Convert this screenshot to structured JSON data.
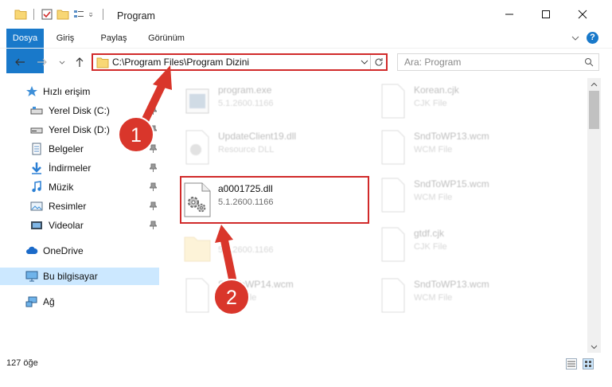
{
  "window": {
    "title": "Program",
    "controls": {
      "minimize": "minimize-icon",
      "maximize": "maximize-icon",
      "close": "close-icon"
    }
  },
  "ribbon": {
    "tabs": [
      "Dosya",
      "Giriş",
      "Paylaş",
      "Görünüm"
    ],
    "help": "?"
  },
  "address_bar": {
    "path": "C:\\Program Files\\Program Dizini",
    "search_placeholder": "Ara: Program"
  },
  "sidebar": {
    "items": [
      {
        "label": "Hızlı erişim",
        "icon": "star-icon",
        "pinned": false
      },
      {
        "label": "Yerel Disk (C:)",
        "icon": "drive-icon",
        "pinned": true
      },
      {
        "label": "Yerel Disk (D:)",
        "icon": "drive-icon",
        "pinned": true
      },
      {
        "label": "Belgeler",
        "icon": "documents-icon",
        "pinned": true
      },
      {
        "label": "İndirmeler",
        "icon": "download-icon",
        "pinned": true
      },
      {
        "label": "Müzik",
        "icon": "music-icon",
        "pinned": true
      },
      {
        "label": "Resimler",
        "icon": "pictures-icon",
        "pinned": true
      },
      {
        "label": "Videolar",
        "icon": "videos-icon",
        "pinned": true
      },
      {
        "label": "OneDrive",
        "icon": "cloud-icon",
        "pinned": false
      },
      {
        "label": "Bu bilgisayar",
        "icon": "computer-icon",
        "pinned": false,
        "selected": true
      },
      {
        "label": "Ağ",
        "icon": "network-icon",
        "pinned": false
      }
    ]
  },
  "files": [
    {
      "name": "program.exe",
      "meta": "5.1.2600.1166",
      "faded": true
    },
    {
      "name": "UpdateClient19.dll",
      "meta": "Resource DLL",
      "faded": true
    },
    {
      "name": "a0001725.dll",
      "meta": "5.1.2600.1166",
      "faded": false
    },
    {
      "name": "",
      "meta": "5.1.2600.1166",
      "faded": true
    },
    {
      "name": "SndToWP14.wcm",
      "meta": "WCM File",
      "faded": true
    },
    {
      "name": "Korean.cjk",
      "meta": "CJK File",
      "faded": true
    },
    {
      "name": "SndToWP13.wcm",
      "meta": "WCM File",
      "faded": true
    },
    {
      "name": "SndToWP15.wcm",
      "meta": "WCM File",
      "faded": true
    },
    {
      "name": "gtdf.cjk",
      "meta": "CJK File",
      "faded": true
    },
    {
      "name": "SndToWP13.wcm",
      "meta": "WCM File",
      "faded": true
    }
  ],
  "annotations": {
    "step1": "1",
    "step2": "2"
  },
  "status": {
    "count": "127 öğe"
  },
  "colors": {
    "accent": "#1979ca",
    "highlight_border": "#d12a2a",
    "selection": "#cce8ff",
    "step_badge": "#d9362b"
  }
}
